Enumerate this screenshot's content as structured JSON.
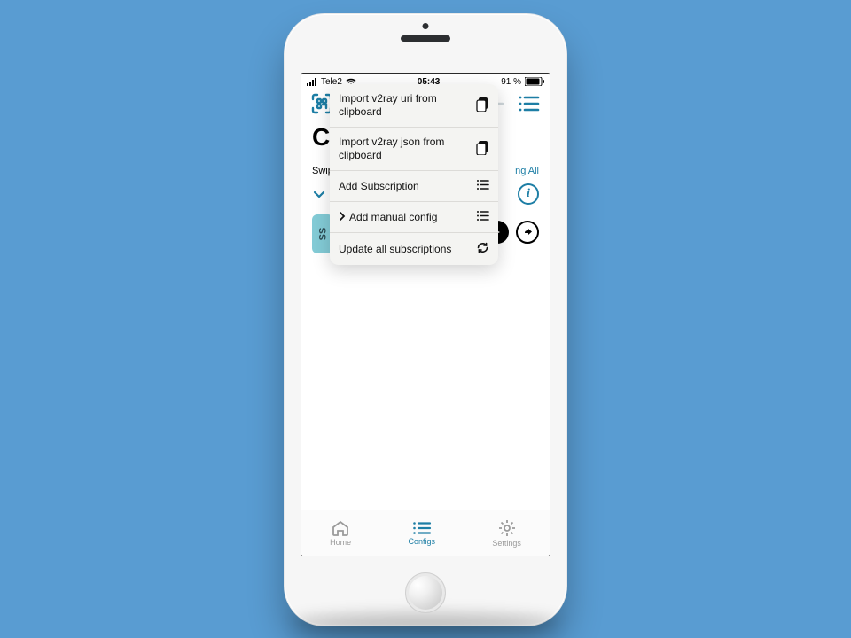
{
  "status": {
    "carrier": "Tele2",
    "clock": "05:43",
    "battery_text": "91 %"
  },
  "toolbar": {
    "qr_icon": "qr-scan-icon",
    "add_icon": "plus-icon",
    "list_icon": "list-icon"
  },
  "title": "Co",
  "hint": "Swipe",
  "ping_link": "ng All",
  "expand_row": {
    "info_glyph": "i"
  },
  "ss": {
    "label": "SS"
  },
  "menu": {
    "items": [
      {
        "label": "Import v2ray uri from clipboard",
        "icon": "clipboard-icon",
        "has_chevron": false
      },
      {
        "label": "Import v2ray json from clipboard",
        "icon": "clipboard-icon",
        "has_chevron": false
      },
      {
        "label": "Add Subscription",
        "icon": "list-icon",
        "has_chevron": false
      },
      {
        "label": "Add manual config",
        "icon": "list-icon",
        "has_chevron": true
      },
      {
        "label": "Update all subscriptions",
        "icon": "refresh-icon",
        "has_chevron": false
      }
    ]
  },
  "tabs": {
    "items": [
      {
        "label": "Home",
        "icon": "home-icon",
        "active": false
      },
      {
        "label": "Configs",
        "icon": "list-icon",
        "active": true
      },
      {
        "label": "Settings",
        "icon": "gear-icon",
        "active": false
      }
    ]
  }
}
